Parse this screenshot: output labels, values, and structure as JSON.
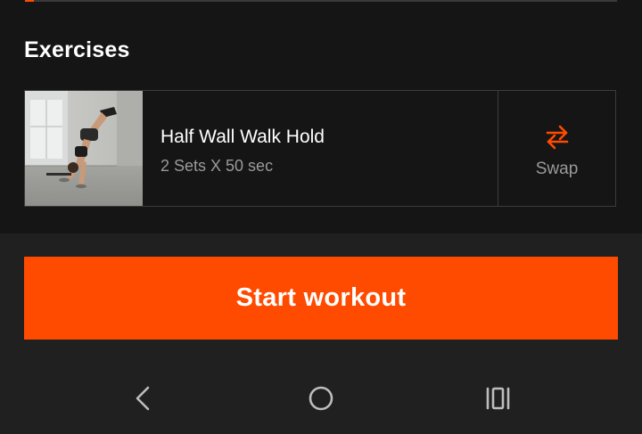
{
  "progress": {
    "fraction": 0.015,
    "color": "#ff4b00"
  },
  "exercises_section": {
    "title": "Exercises"
  },
  "exercise": {
    "name": "Half Wall Walk Hold",
    "detail": "2 Sets X 50 sec",
    "thumbnail_icon": "handstand-photo"
  },
  "swap": {
    "label": "Swap",
    "icon": "swap-arrows-icon",
    "icon_color": "#ff4b00"
  },
  "start_button": {
    "label": "Start workout",
    "color": "#ff4b00"
  },
  "navigation": {
    "back_icon": "back-chevron-icon",
    "home_icon": "home-circle-icon",
    "recents_icon": "recents-icon"
  },
  "colors": {
    "accent": "#ff4b00",
    "background": "#151515",
    "bottom_background": "#202020"
  }
}
